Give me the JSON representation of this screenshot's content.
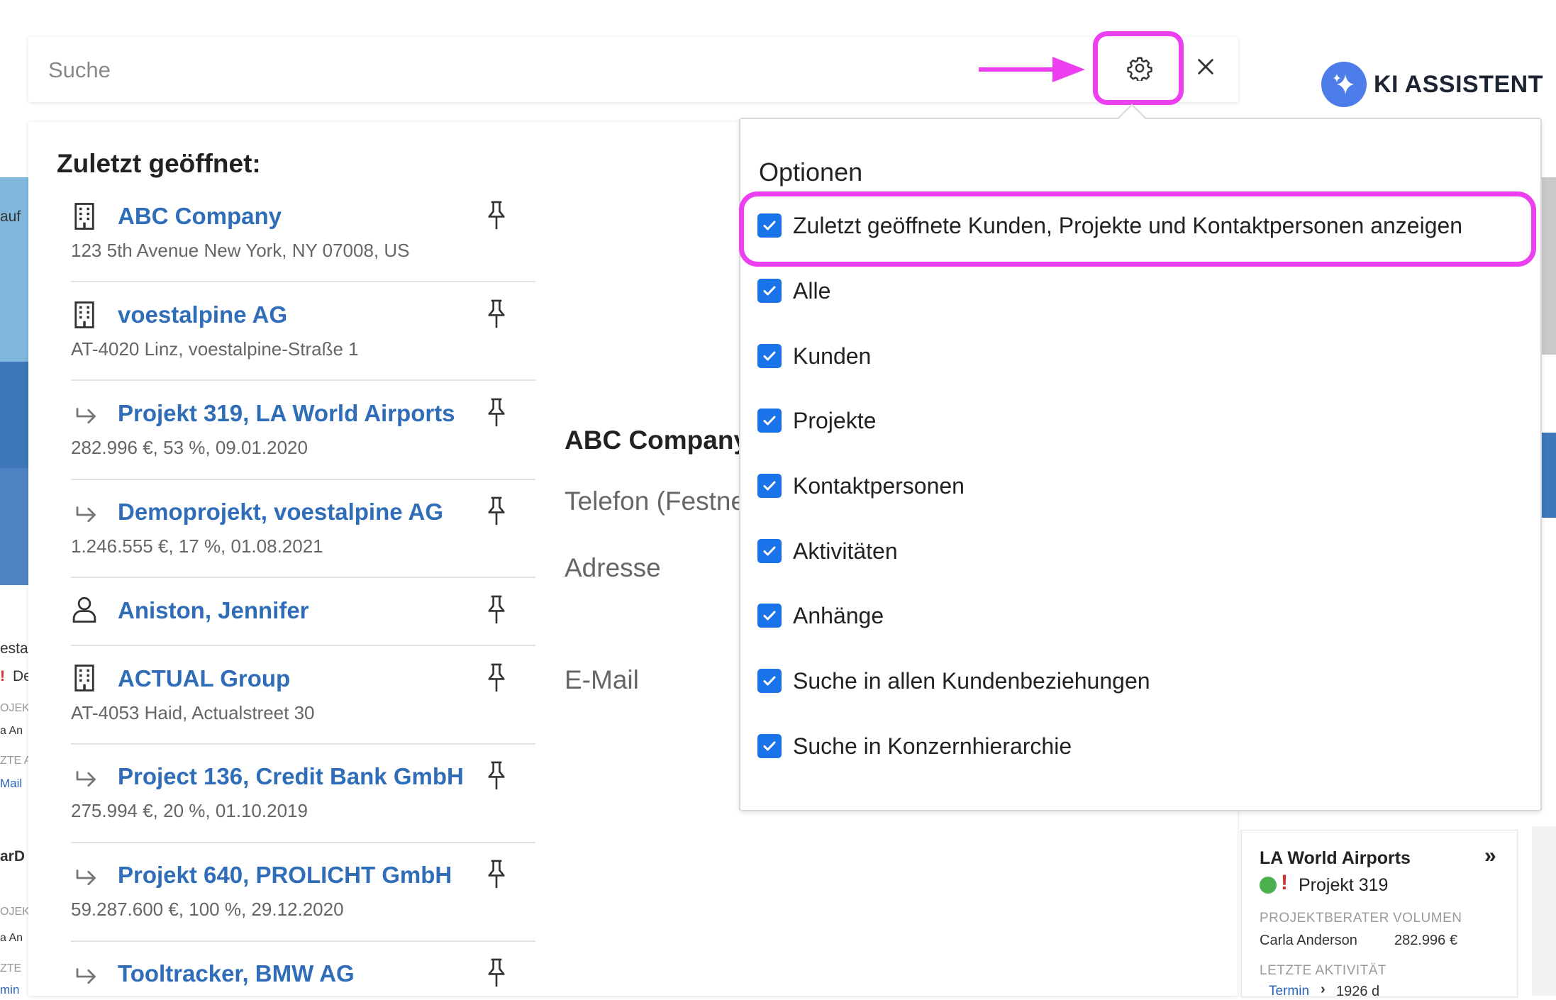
{
  "search": {
    "placeholder": "Suche"
  },
  "ki_assistant": {
    "label": "KI ASSISTENT"
  },
  "recent": {
    "title": "Zuletzt geöffnet:",
    "items": [
      {
        "type": "company",
        "icon": "building-icon",
        "title": "ABC Company",
        "subtitle": "123 5th Avenue New York, NY 07008, US"
      },
      {
        "type": "company",
        "icon": "building-icon",
        "title": "voestalpine AG",
        "subtitle": "AT-4020 Linz, voestalpine-Straße 1"
      },
      {
        "type": "project",
        "icon": "project-arrow-icon",
        "title": "Projekt 319, LA World Airports",
        "subtitle": "282.996 €, 53 %, 09.01.2020"
      },
      {
        "type": "project",
        "icon": "project-arrow-icon",
        "title": "Demoprojekt, voestalpine AG",
        "subtitle": "1.246.555 €, 17 %, 01.08.2021"
      },
      {
        "type": "person",
        "icon": "person-icon",
        "title": "Aniston, Jennifer",
        "subtitle": ""
      },
      {
        "type": "company",
        "icon": "building-icon",
        "title": "ACTUAL Group",
        "subtitle": "AT-4053 Haid, Actualstreet 30"
      },
      {
        "type": "project",
        "icon": "project-arrow-icon",
        "title": "Project 136, Credit Bank GmbH",
        "subtitle": "275.994 €, 20 %, 01.10.2019"
      },
      {
        "type": "project",
        "icon": "project-arrow-icon",
        "title": "Projekt 640, PROLICHT GmbH",
        "subtitle": "59.287.600 €, 100 %, 29.12.2020"
      },
      {
        "type": "project",
        "icon": "project-arrow-icon",
        "title": "Tooltracker, BMW AG",
        "subtitle": ""
      }
    ]
  },
  "detail": {
    "title": "ABC Company",
    "labels": [
      "Telefon (Festnetz)",
      "Adresse",
      "E-Mail"
    ]
  },
  "options": {
    "title": "Optionen",
    "items": [
      {
        "label": "Zuletzt geöffnete Kunden, Projekte und Kontaktpersonen anzeigen",
        "checked": true
      },
      {
        "label": "Alle",
        "checked": true
      },
      {
        "label": "Kunden",
        "checked": true
      },
      {
        "label": "Projekte",
        "checked": true
      },
      {
        "label": "Kontaktpersonen",
        "checked": true
      },
      {
        "label": "Aktivitäten",
        "checked": true
      },
      {
        "label": "Anhänge",
        "checked": true
      },
      {
        "label": "Suche in allen Kundenbeziehungen",
        "checked": true
      },
      {
        "label": "Suche in Konzernhierarchie",
        "checked": true
      }
    ]
  },
  "background_left": {
    "text1": "auf",
    "text2": "esta",
    "text3": "De",
    "small1": "OJEKT",
    "small2": "a An",
    "small3": "ZTE A",
    "link1": "Mail",
    "text4": "arD",
    "small4": "OJEKT",
    "small5": "a An",
    "small6": "ZTE",
    "link2": "min"
  },
  "card": {
    "title": "LA World Airports",
    "project": "Projekt 319",
    "label_advisor": "PROJEKTBERATER",
    "label_volume": "VOLUMEN",
    "advisor": "Carla Anderson",
    "volume": "282.996 €",
    "label_last_activity": "LETZTE AKTIVITÄT",
    "activity_type": "Termin",
    "activity_age": "1926 d"
  },
  "colors": {
    "highlight": "#ec3ff0",
    "link": "#2f6db8",
    "checkbox": "#1a73e8",
    "ki": "#4d7de9"
  }
}
